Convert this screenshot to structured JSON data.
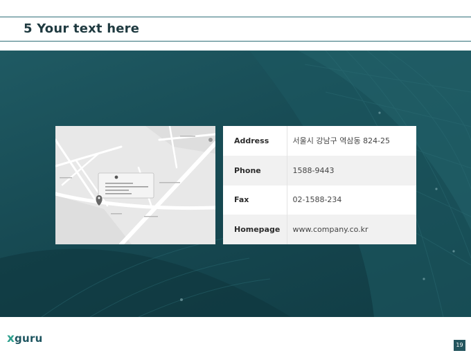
{
  "slide": {
    "title": "5 Your text here",
    "page_number": "19"
  },
  "contact_table": {
    "rows": [
      {
        "label": "Address",
        "value": "서울시 강남구 역삼동 824-25"
      },
      {
        "label": "Phone",
        "value": "1588-9443"
      },
      {
        "label": "Fax",
        "value": "02-1588-234"
      },
      {
        "label": "Homepage",
        "value": "www.company.co.kr"
      }
    ]
  },
  "logo": {
    "mark": "x",
    "name": "guru"
  },
  "colors": {
    "accent": "#2f6e78",
    "hero_background": "#174a53",
    "logo_mark": "#2fa08e",
    "page_badge": "#24555e"
  }
}
